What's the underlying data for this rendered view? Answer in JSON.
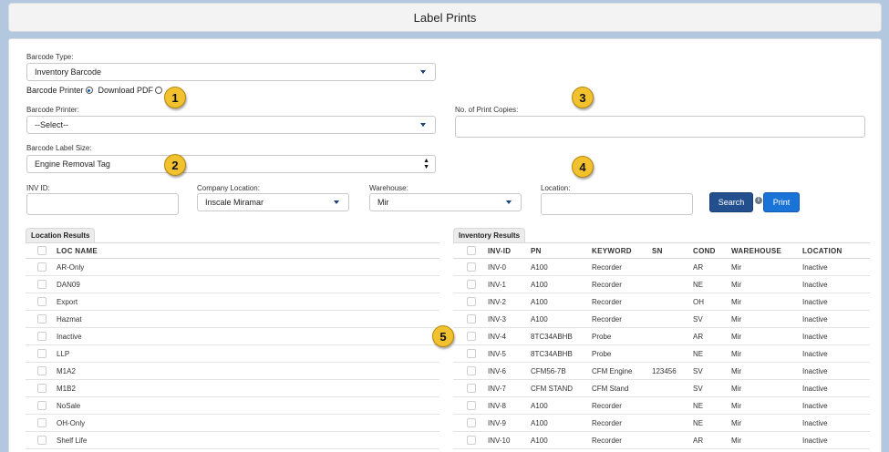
{
  "header": {
    "title": "Label Prints"
  },
  "form": {
    "barcode_type": {
      "label": "Barcode Type:",
      "value": "Inventory Barcode"
    },
    "output": {
      "printer_label": "Barcode Printer",
      "pdf_label": "Download PDF",
      "selected": "Barcode Printer"
    },
    "barcode_printer": {
      "label": "Barcode Printer:",
      "value": "--Select--"
    },
    "print_copies": {
      "label": "No. of Print Copies:",
      "value": ""
    },
    "label_size": {
      "label": "Barcode Label Size:",
      "value": "Engine Removal Tag"
    },
    "inv_id": {
      "label": "INV ID:",
      "value": ""
    },
    "company_location": {
      "label": "Company Location:",
      "value": "Inscale Miramar"
    },
    "warehouse": {
      "label": "Warehouse:",
      "value": "Mir"
    },
    "location": {
      "label": "Location:",
      "value": ""
    },
    "search_button": "Search",
    "print_button": "Print",
    "info_icon": "i"
  },
  "callouts": [
    "1",
    "2",
    "3",
    "4",
    "5"
  ],
  "location_results": {
    "tab": "Location Results",
    "column": "LOC NAME",
    "rows": [
      "AR-Only",
      "DAN09",
      "Export",
      "Hazmat",
      "Inactive",
      "LLP",
      "M1A2",
      "M1B2",
      "NoSale",
      "OH-Only",
      "Shelf Life"
    ]
  },
  "inventory_results": {
    "tab": "Inventory Results",
    "columns": [
      "INV-ID",
      "PN",
      "KEYWORD",
      "SN",
      "COND",
      "WAREHOUSE",
      "LOCATION"
    ],
    "rows": [
      [
        "INV-0",
        "A100",
        "Recorder",
        "",
        "AR",
        "Mir",
        "Inactive"
      ],
      [
        "INV-1",
        "A100",
        "Recorder",
        "",
        "NE",
        "Mir",
        "Inactive"
      ],
      [
        "INV-2",
        "A100",
        "Recorder",
        "",
        "OH",
        "Mir",
        "Inactive"
      ],
      [
        "INV-3",
        "A100",
        "Recorder",
        "",
        "SV",
        "Mir",
        "Inactive"
      ],
      [
        "INV-4",
        "8TC34ABHB",
        "Probe",
        "",
        "AR",
        "Mir",
        "Inactive"
      ],
      [
        "INV-5",
        "8TC34ABHB",
        "Probe",
        "",
        "NE",
        "Mir",
        "Inactive"
      ],
      [
        "INV-6",
        "CFM56-7B",
        "CFM Engine",
        "123456",
        "SV",
        "Mir",
        "Inactive"
      ],
      [
        "INV-7",
        "CFM STAND",
        "CFM Stand",
        "",
        "SV",
        "Mir",
        "Inactive"
      ],
      [
        "INV-8",
        "A100",
        "Recorder",
        "",
        "NE",
        "Mir",
        "Inactive"
      ],
      [
        "INV-9",
        "A100",
        "Recorder",
        "",
        "NE",
        "Mir",
        "Inactive"
      ],
      [
        "INV-10",
        "A100",
        "Recorder",
        "",
        "AR",
        "Mir",
        "Inactive"
      ]
    ]
  }
}
